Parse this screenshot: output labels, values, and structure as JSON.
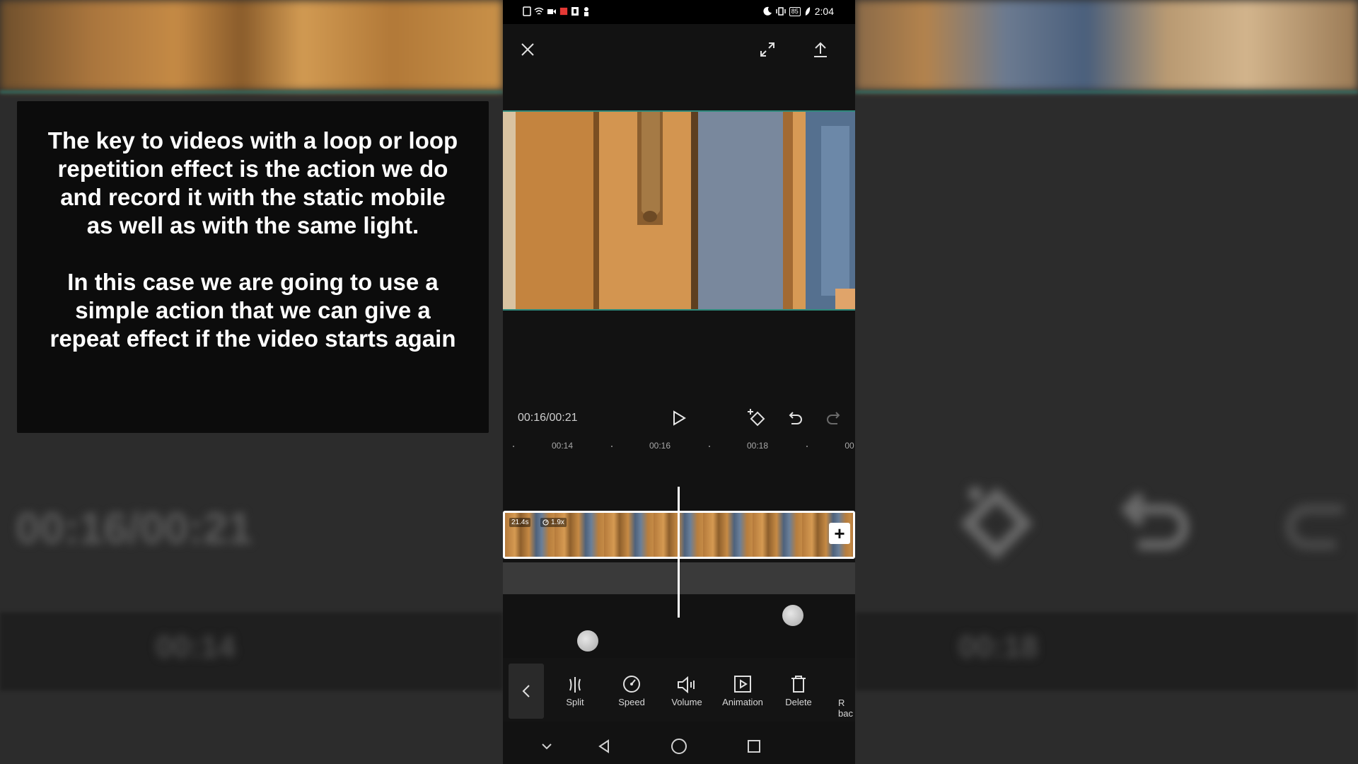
{
  "caption": {
    "paragraph1": "The key to videos with a loop or loop repetition effect is the action we do and record it with the static mobile as well as with the same light.",
    "paragraph2": "In this case we are going to use a simple action that we can give a repeat effect if the video starts again"
  },
  "background_blur": {
    "time_readout": "00:16/00:21",
    "tick_left": "00:14",
    "tick_right": "00:18"
  },
  "status_bar": {
    "time": "2:04",
    "battery": "85"
  },
  "editor": {
    "timecode": "00:16/00:21",
    "ruler_ticks": [
      "00:14",
      "00:16",
      "00:18",
      "00"
    ],
    "clip": {
      "duration_label": "21.4s",
      "speed_label": "1.9x"
    }
  },
  "toolbar": {
    "items": [
      {
        "label": "Split",
        "icon": "split-icon"
      },
      {
        "label": "Speed",
        "icon": "speed-icon"
      },
      {
        "label": "Volume",
        "icon": "volume-icon"
      },
      {
        "label": "Animation",
        "icon": "animation-icon"
      },
      {
        "label": "Delete",
        "icon": "delete-icon"
      }
    ],
    "cut_label_line1": "R",
    "cut_label_line2": "bac"
  },
  "colors": {
    "accent_teal": "#2f8a7c",
    "caption_bg": "#0c0c0c"
  }
}
